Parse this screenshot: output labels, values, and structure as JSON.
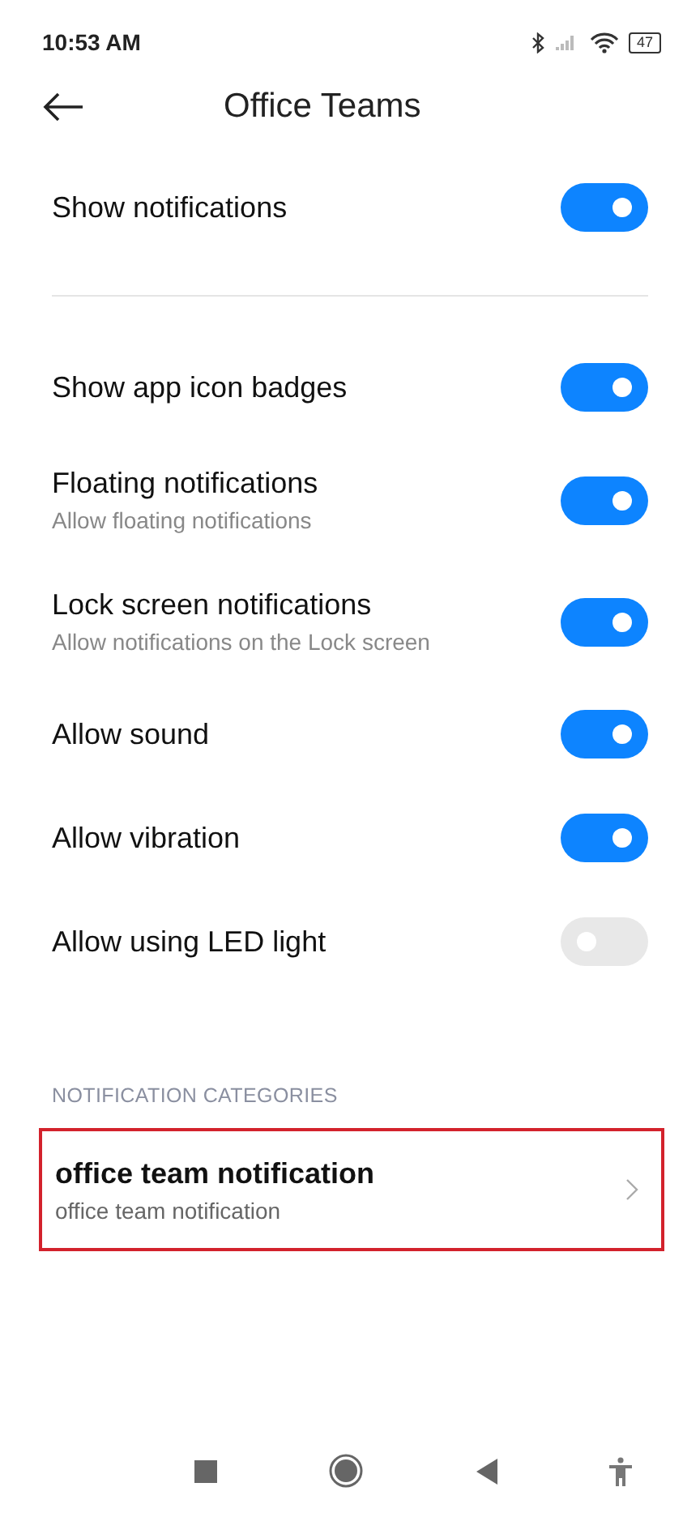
{
  "status_bar": {
    "time": "10:53 AM",
    "battery": "47"
  },
  "header": {
    "title": "Office Teams"
  },
  "main_toggle": {
    "title": "Show notifications",
    "on": true
  },
  "settings": [
    {
      "title": "Show app icon badges",
      "on": true
    },
    {
      "title": "Floating notifications",
      "subtitle": "Allow floating notifications",
      "on": true
    },
    {
      "title": "Lock screen notifications",
      "subtitle": "Allow notifications on the Lock screen",
      "on": true
    },
    {
      "title": "Allow sound",
      "on": true
    },
    {
      "title": "Allow vibration",
      "on": true
    },
    {
      "title": "Allow using LED light",
      "on": false
    }
  ],
  "categories": {
    "heading": "NOTIFICATION CATEGORIES",
    "items": [
      {
        "title": "office team notification",
        "subtitle": "office team notification",
        "highlighted": true
      }
    ]
  }
}
